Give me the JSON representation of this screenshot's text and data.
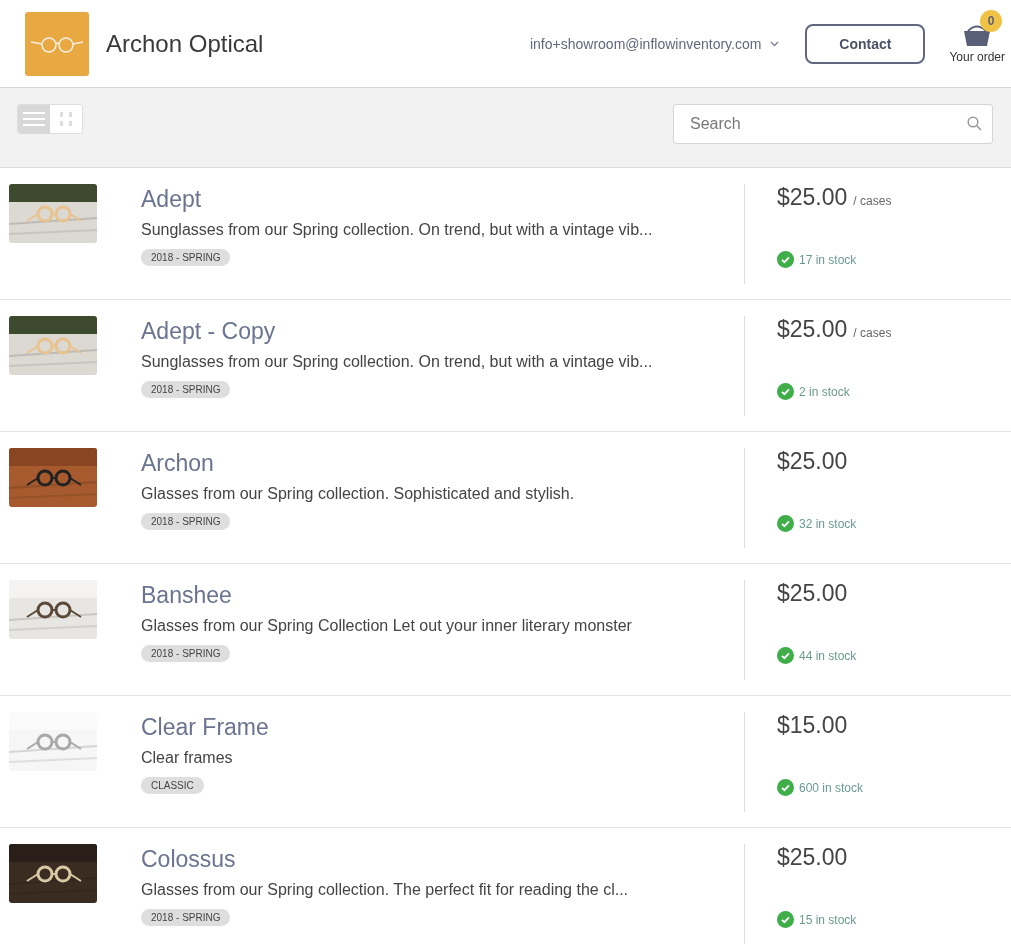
{
  "store": {
    "name": "Archon Optical",
    "account": "info+showroom@inflowinventory.com",
    "contact_button": "Contact",
    "cart": {
      "count": "0",
      "label": "Your order"
    }
  },
  "toolbar": {
    "views": [
      {
        "kind": "list",
        "selected": true
      },
      {
        "kind": "grid",
        "selected": false
      }
    ],
    "search": {
      "placeholder": "Search"
    }
  },
  "products": [
    {
      "name": "Adept",
      "description": "Sunglasses from our Spring collection. On trend, but with a vintage vib...",
      "tag": "2018 - SPRING",
      "price": "$25.00",
      "unit": "/ cases",
      "stock": "17 in stock",
      "in_stock": true,
      "kind": "picture"
    },
    {
      "name": "Adept - Copy",
      "description": "Sunglasses from our Spring collection. On trend, but with a vintage vib...",
      "tag": "2018 - SPRING",
      "price": "$25.00",
      "unit": "/ cases",
      "stock": "2 in stock",
      "in_stock": true,
      "kind": "picture"
    },
    {
      "name": "Archon",
      "description": "Glasses from our Spring collection. Sophisticated and stylish.",
      "tag": "2018 - SPRING",
      "price": "$25.00",
      "stock": "32 in stock",
      "in_stock": true,
      "kind": "picture"
    },
    {
      "name": "Banshee",
      "description": "Glasses from our Spring Collection Let out your inner literary monster",
      "tag": "2018 - SPRING",
      "price": "$25.00",
      "stock": "44 in stock",
      "in_stock": true,
      "kind": "picture"
    },
    {
      "name": "Clear Frame",
      "description": "Clear frames",
      "tag": "CLASSIC",
      "price": "$15.00",
      "stock": "600 in stock",
      "in_stock": true,
      "kind": "picture"
    },
    {
      "name": "Colossus",
      "description": "Glasses from our Spring collection. The perfect fit for reading the cl...",
      "tag": "2018 - SPRING",
      "price": "$25.00",
      "stock": "15 in stock",
      "in_stock": true,
      "kind": "picture"
    }
  ]
}
